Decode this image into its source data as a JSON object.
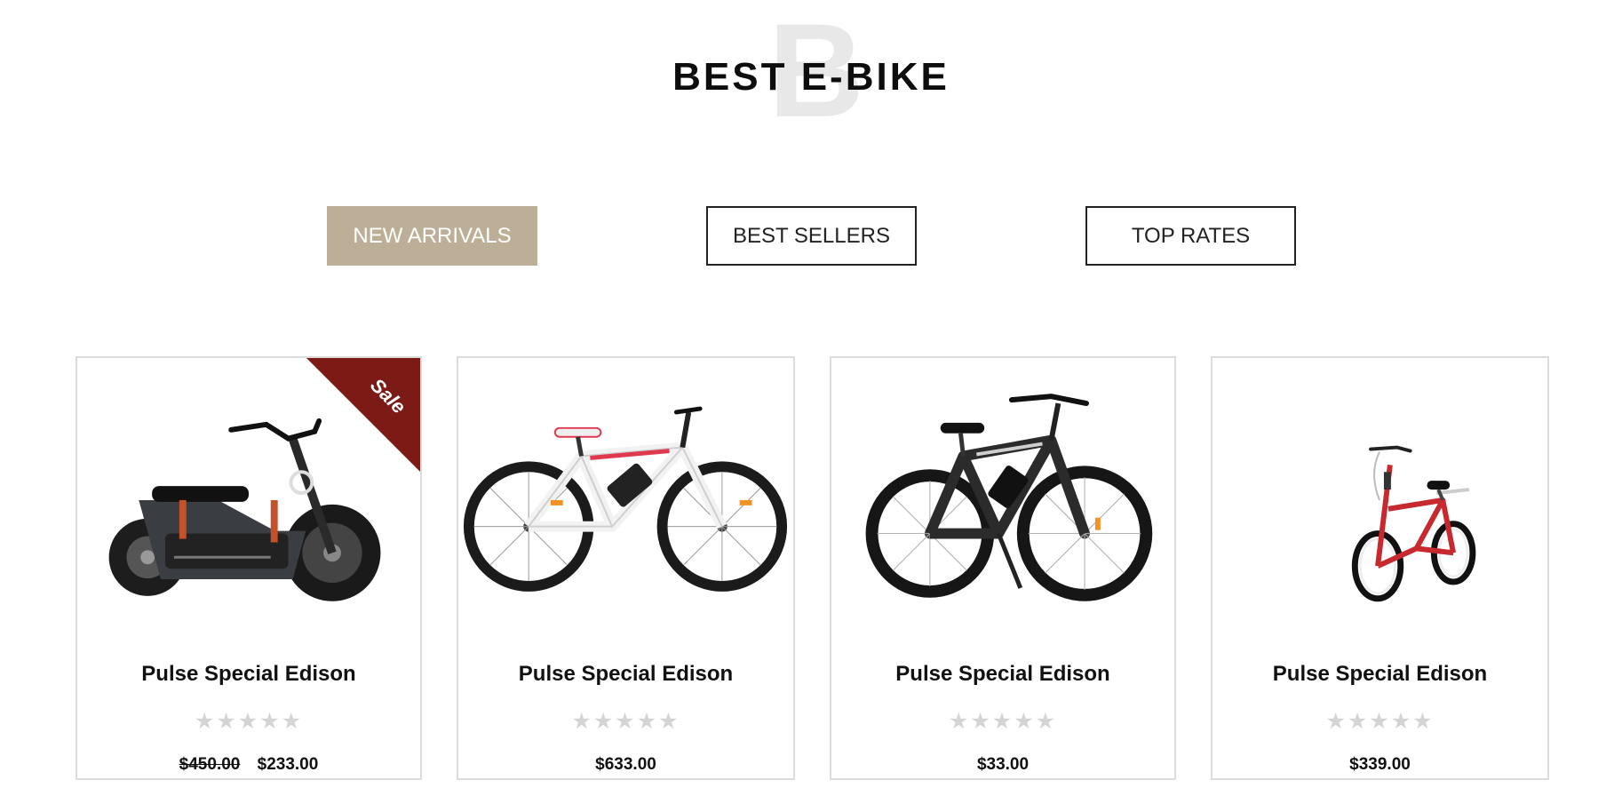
{
  "section": {
    "title": "BEST E-BIKE",
    "watermark": "B"
  },
  "tabs": [
    {
      "label": "NEW ARRIVALS",
      "active": true
    },
    {
      "label": "BEST SELLERS",
      "active": false
    },
    {
      "label": "TOP RATES",
      "active": false
    }
  ],
  "colors": {
    "tab_active": "#bdaf97",
    "sale_badge": "#7c1a16",
    "star_empty": "#d4d4d4"
  },
  "products": [
    {
      "name": "Pulse Special Edison",
      "badge": "Sale",
      "rating": 0,
      "rating_max": 5,
      "stars": "★★★★★",
      "old_price": "$450.00",
      "price": "$233.00",
      "image_icon": "electric-motorbike-icon"
    },
    {
      "name": "Pulse Special Edison",
      "rating": 0,
      "rating_max": 5,
      "stars": "★★★★★",
      "price": "$633.00",
      "image_icon": "mountain-ebike-white-icon"
    },
    {
      "name": "Pulse Special Edison",
      "rating": 0,
      "rating_max": 5,
      "stars": "★★★★★",
      "price": "$33.00",
      "image_icon": "mountain-ebike-black-icon"
    },
    {
      "name": "Pulse Special Edison",
      "rating": 0,
      "rating_max": 5,
      "stars": "★★★★★",
      "price": "$339.00",
      "image_icon": "folding-bike-red-icon"
    }
  ]
}
